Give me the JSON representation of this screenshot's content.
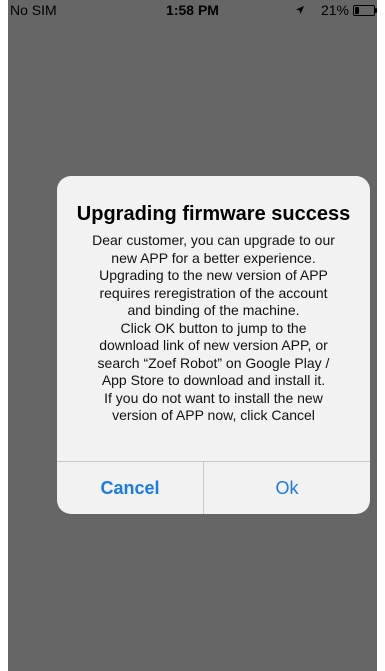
{
  "status_bar": {
    "carrier": "No SIM",
    "time": "1:58 PM",
    "battery_percent": "21%",
    "battery_level": 0.21,
    "icons": [
      "location-arrow-icon",
      "bluetooth-icon",
      "battery-icon"
    ]
  },
  "dialog": {
    "title": "Upgrading firmware success",
    "message_lines": [
      "Dear customer, you can upgrade to our",
      "new APP for a better experience.",
      "Upgrading to the new version of APP",
      "requires reregistration of the account",
      "and binding of the machine.",
      "Click OK button to jump to the",
      "download link of new version APP, or",
      "search “Zoef Robot” on Google Play /",
      "App Store to download and install it.",
      "If you do not want to install the new",
      "version of APP now, click Cancel"
    ],
    "cancel_label": "Cancel",
    "ok_label": "Ok"
  },
  "colors": {
    "backdrop": "#666666",
    "dialog_bg": "#f2f2f2",
    "button_text": "#1a7ae6",
    "divider": "#c9c9c9"
  }
}
